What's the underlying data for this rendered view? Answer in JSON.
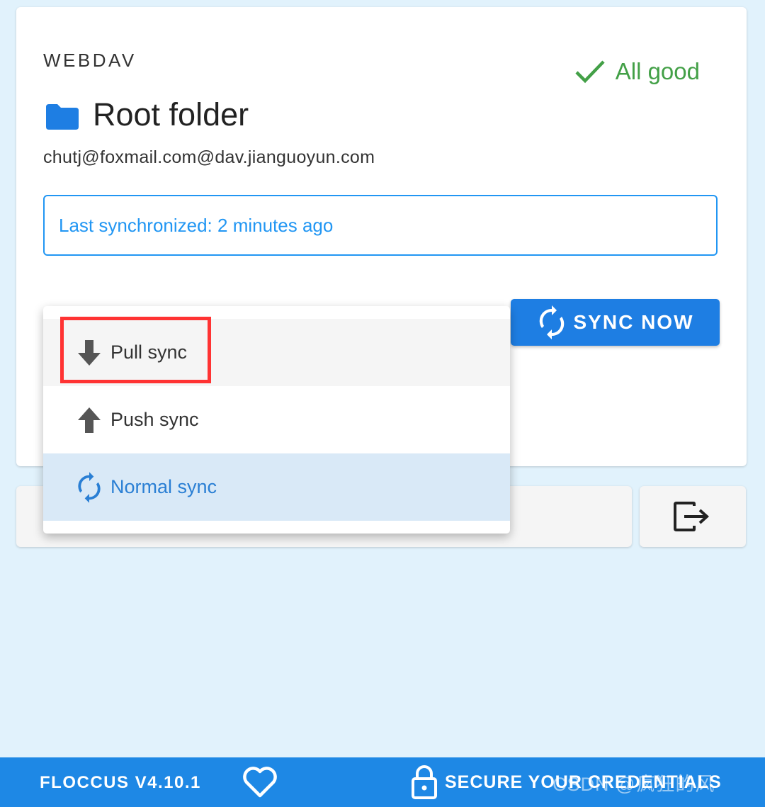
{
  "account_card": {
    "type_label": "WEBDAV",
    "status_text": "All good",
    "title": "Root folder",
    "account": "chutj@foxmail.com@dav.jianguoyun.com",
    "last_sync": "Last synchronized: 2 minutes ago",
    "sync_button_label": "SYNC NOW"
  },
  "sync_menu": {
    "items": [
      {
        "label": "Pull sync",
        "icon": "arrow-down-icon",
        "state": "hover"
      },
      {
        "label": "Push sync",
        "icon": "arrow-up-icon",
        "state": "normal"
      },
      {
        "label": "Normal sync",
        "icon": "sync-icon",
        "state": "selected"
      }
    ]
  },
  "footer": {
    "version": "FLOCCUS V4.10.1",
    "secure_label": "SECURE YOUR CREDENTIALS",
    "watermark": "CSDN @疯狂的风"
  },
  "colors": {
    "background": "#e1f2fc",
    "accent": "#1e7ee3",
    "status_ok": "#43a047",
    "highlight": "#ff3333"
  }
}
